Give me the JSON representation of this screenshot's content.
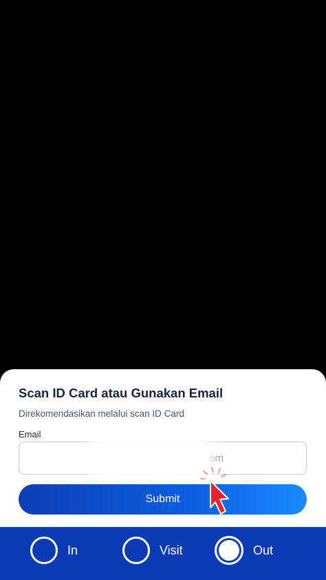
{
  "sheet": {
    "title": "Scan ID Card atau Gunakan Email",
    "subtitle": "Direkomendasikan melalui scan ID Card",
    "email_label": "Email",
    "email_placeholder": "om",
    "submit_label": "Submit"
  },
  "bottom_bar": {
    "modes": [
      {
        "label": "In",
        "selected": false
      },
      {
        "label": "Visit",
        "selected": false
      },
      {
        "label": "Out",
        "selected": true
      }
    ]
  },
  "colors": {
    "bar": "#0b3ab5",
    "button_start": "#0c3fb6",
    "button_end": "#1a8bff",
    "pointer": "#e8232f"
  }
}
